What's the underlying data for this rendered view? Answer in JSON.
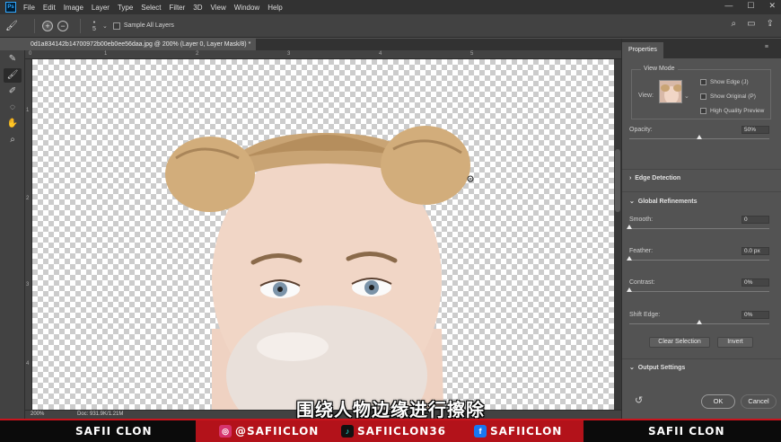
{
  "menubar": {
    "logo": "Ps",
    "items": [
      "File",
      "Edit",
      "Image",
      "Layer",
      "Type",
      "Select",
      "Filter",
      "3D",
      "View",
      "Window",
      "Help"
    ],
    "controls": [
      "—",
      "☐",
      "✕"
    ]
  },
  "options": {
    "brush_size": "5",
    "sample_all_layers": "Sample All Layers"
  },
  "document": {
    "tab_title": "0d1a834142b14700972b00eb0ee56daa.jpg @ 200% (Layer 0, Layer Mask/8) *"
  },
  "rulers": {
    "top": [
      "0",
      "1",
      "2",
      "3",
      "4",
      "5"
    ],
    "left": [
      "1",
      "2",
      "3",
      "4"
    ]
  },
  "status": {
    "zoom": "200%",
    "doc_info": "Doc: 931.9K/1.21M"
  },
  "subtitle": "围绕人物边缘进行擦除",
  "properties": {
    "tab": "Properties",
    "view_mode": {
      "title": "View Mode",
      "view_label": "View:",
      "show_edge": "Show Edge (J)",
      "show_original": "Show Original (P)",
      "high_quality": "High Quality Preview"
    },
    "opacity": {
      "label": "Opacity:",
      "value": "50%",
      "fraction": 0.5
    },
    "edge_detection": "Edge Detection",
    "global_refinements": "Global Refinements",
    "smooth": {
      "label": "Smooth:",
      "value": "0",
      "fraction": 0
    },
    "feather": {
      "label": "Feather:",
      "value": "0.0 px",
      "fraction": 0
    },
    "contrast": {
      "label": "Contrast:",
      "value": "0%",
      "fraction": 0
    },
    "shift_edge": {
      "label": "Shift Edge:",
      "value": "0%",
      "fraction": 0.5
    },
    "clear_selection": "Clear Selection",
    "invert": "Invert",
    "output_settings": "Output Settings",
    "ok": "OK",
    "cancel": "Cancel"
  },
  "branding": {
    "left": "SAFII CLON",
    "instagram": "@SAFIICLON",
    "tiktok": "SAFIICLON36",
    "facebook": "SAFIICLON",
    "right": "SAFII CLON"
  }
}
